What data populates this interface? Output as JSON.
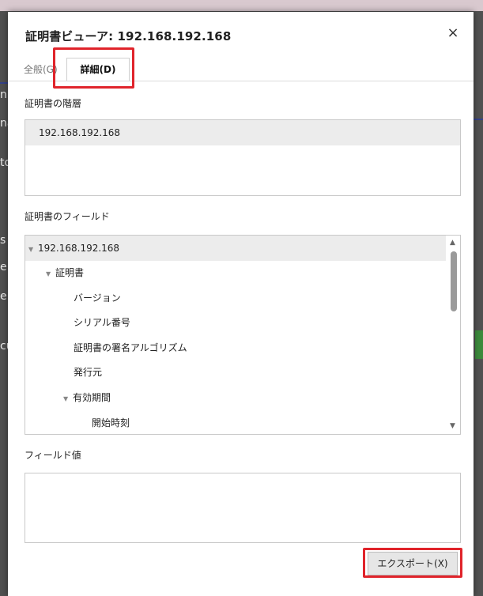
{
  "background_page": {
    "fragments": [
      "n",
      "na",
      "to",
      "s",
      "e",
      "e",
      "cu"
    ]
  },
  "dialog": {
    "title": "証明書ビューア: 192.168.192.168",
    "close_glyph": "×",
    "tabs": [
      {
        "label": "全般(G)",
        "selected": false
      },
      {
        "label": "詳細(D)",
        "selected": true
      }
    ],
    "hierarchy": {
      "label": "証明書の階層",
      "items": [
        "192.168.192.168"
      ]
    },
    "fields": {
      "label": "証明書のフィールド",
      "items": [
        {
          "text": "192.168.192.168",
          "expander": "▼"
        },
        {
          "text": "証明書",
          "expander": "▼"
        },
        {
          "text": "バージョン",
          "expander": ""
        },
        {
          "text": "シリアル番号",
          "expander": ""
        },
        {
          "text": "証明書の署名アルゴリズム",
          "expander": ""
        },
        {
          "text": "発行元",
          "expander": ""
        },
        {
          "text": "有効期間",
          "expander": "▼"
        },
        {
          "text": "開始時刻",
          "expander": ""
        }
      ],
      "scroll_up_glyph": "▲",
      "scroll_down_glyph": "▼"
    },
    "field_value": {
      "label": "フィールド値",
      "value": ""
    },
    "export_button": "エクスポート(X)"
  },
  "colors": {
    "highlight": "#e0242b",
    "selected_row": "#ececec"
  }
}
